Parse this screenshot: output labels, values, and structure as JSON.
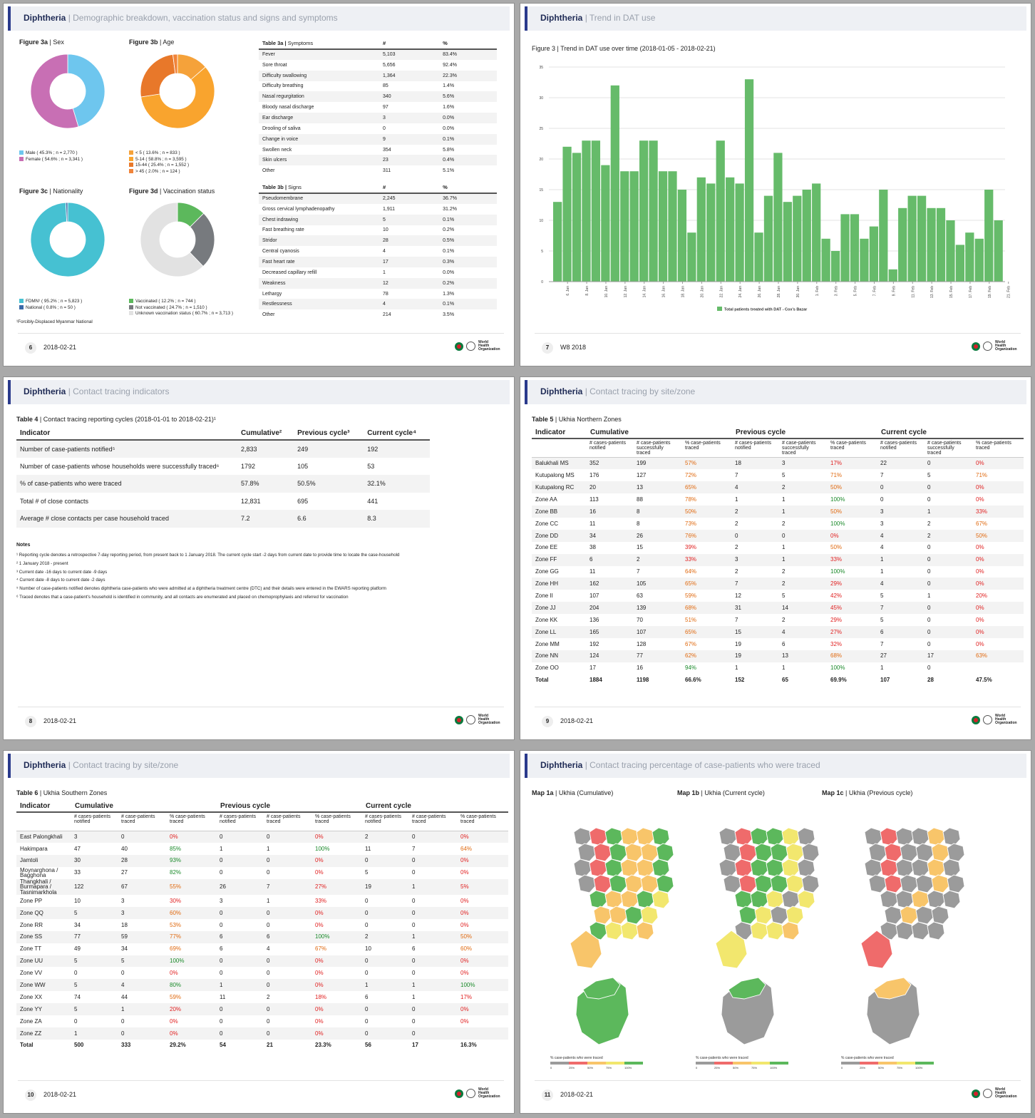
{
  "brand": {
    "title": "Diphtheria",
    "who_line1": "World Health",
    "who_line2": "Organization"
  },
  "slides": {
    "s1": {
      "subtitle": "Demographic breakdown, vaccination status and signs and symptoms",
      "page": "6",
      "date": "2018-02-21"
    },
    "s2": {
      "subtitle": "Trend in DAT use",
      "page": "7",
      "date": "W8 2018"
    },
    "s3": {
      "subtitle": "Contact tracing indicators",
      "page": "8",
      "date": "2018-02-21"
    },
    "s4": {
      "subtitle": "Contact tracing by site/zone",
      "page": "9",
      "date": "2018-02-21"
    },
    "s5": {
      "subtitle": "Contact tracing by site/zone",
      "page": "10",
      "date": "2018-02-21"
    },
    "s6": {
      "subtitle": "Contact tracing percentage of case-patients who were traced",
      "page": "11",
      "date": "2018-02-21"
    }
  },
  "demographics": {
    "sex": {
      "fig": "Figure 3a",
      "name": "Sex",
      "slices": [
        {
          "label": "Male ( 45.3% ; n = 2,770 )",
          "value": 45.3,
          "color": "#6ec6ee"
        },
        {
          "label": "Female ( 54.6% ; n = 3,341 )",
          "value": 54.6,
          "color": "#c86fb4"
        }
      ]
    },
    "age": {
      "fig": "Figure 3b",
      "name": "Age",
      "slices": [
        {
          "label": "< 5 ( 13.6% ; n = 833 )",
          "value": 13.6,
          "color": "#f5a23a"
        },
        {
          "label": "5-14 ( 58.8% ; n = 3,595 )",
          "value": 58.8,
          "color": "#f9a42e"
        },
        {
          "label": "15-44 ( 25.4% ; n = 1,552 )",
          "value": 25.4,
          "color": "#e8782a"
        },
        {
          "label": "> 45 ( 2.0% ; n = 124 )",
          "value": 2.0,
          "color": "#f1843a"
        }
      ]
    },
    "nationality": {
      "fig": "Figure 3c",
      "name": "Nationality",
      "slices": [
        {
          "label": "FDMN¹ ( 95.2% ; n = 5,823 )",
          "value": 95.2,
          "color": "#46c1d2"
        },
        {
          "label": "National ( 0.8% ; n = 50 )",
          "value": 0.8,
          "color": "#3a69a8"
        }
      ]
    },
    "vaccination": {
      "fig": "Figure 3d",
      "name": "Vaccination status",
      "slices": [
        {
          "label": "Vaccinated ( 12.2% ; n = 744 )",
          "value": 12.2,
          "color": "#5cb85c"
        },
        {
          "label": "Not vaccinated ( 24.7% ; n = 1,510 )",
          "value": 24.7,
          "color": "#777a7e"
        },
        {
          "label": "Unknown vaccination status ( 60.7% ; n = 3,713 )",
          "value": 60.7,
          "color": "#e2e2e2"
        }
      ]
    },
    "footnote": "¹Forcibly-Displaced Myanmar National"
  },
  "symptoms": {
    "fig": "Table 3a",
    "name": "Symptoms",
    "col_n": "#",
    "col_p": "%",
    "rows": [
      [
        "Fever",
        "5,103",
        "83.4%"
      ],
      [
        "Sore throat",
        "5,656",
        "92.4%"
      ],
      [
        "Difficulty swallowing",
        "1,364",
        "22.3%"
      ],
      [
        "Difficulty breathing",
        "85",
        "1.4%"
      ],
      [
        "Nasal regurgitation",
        "340",
        "5.6%"
      ],
      [
        "Bloody nasal discharge",
        "97",
        "1.6%"
      ],
      [
        "Ear discharge",
        "3",
        "0.0%"
      ],
      [
        "Drooling of saliva",
        "0",
        "0.0%"
      ],
      [
        "Change in voice",
        "9",
        "0.1%"
      ],
      [
        "Swollen neck",
        "354",
        "5.8%"
      ],
      [
        "Skin ulcers",
        "23",
        "0.4%"
      ],
      [
        "Other",
        "311",
        "5.1%"
      ]
    ]
  },
  "signs": {
    "fig": "Table 3b",
    "name": "Signs",
    "col_n": "#",
    "col_p": "%",
    "rows": [
      [
        "Pseudomembrane",
        "2,245",
        "36.7%"
      ],
      [
        "Gross cervical lymphadenopathy",
        "1,911",
        "31.2%"
      ],
      [
        "Chest indrawing",
        "5",
        "0.1%"
      ],
      [
        "Fast breathing rate",
        "10",
        "0.2%"
      ],
      [
        "Stridor",
        "28",
        "0.5%"
      ],
      [
        "Central cyanosis",
        "4",
        "0.1%"
      ],
      [
        "Fast heart rate",
        "17",
        "0.3%"
      ],
      [
        "Decreased capillary refill",
        "1",
        "0.0%"
      ],
      [
        "Weakness",
        "12",
        "0.2%"
      ],
      [
        "Lethargy",
        "78",
        "1.3%"
      ],
      [
        "Restlessness",
        "4",
        "0.1%"
      ],
      [
        "Other",
        "214",
        "3.5%"
      ]
    ]
  },
  "chart_data": {
    "type": "bar",
    "title": "Figure 3 | Trend in DAT use over time (2018-01-05 - 2018-02-21)",
    "ylim": [
      0,
      35
    ],
    "yticks": [
      0,
      5,
      10,
      15,
      20,
      25,
      30,
      35
    ],
    "xticks": [
      "6. Jan",
      "8. Jan",
      "10. Jan",
      "12. Jan",
      "14. Jan",
      "16. Jan",
      "18. Jan",
      "20. Jan",
      "22. Jan",
      "24. Jan",
      "26. Jan",
      "28. Jan",
      "30. Jan",
      "1. Feb",
      "3. Feb",
      "5. Feb",
      "7. Feb",
      "9. Feb",
      "11. Feb",
      "13. Feb",
      "15. Feb",
      "17. Feb",
      "19. Feb",
      "21. Feb"
    ],
    "series": [
      {
        "name": "Total patients treated with DAT - Cox's Bazar",
        "color": "#66bb6a",
        "values": [
          13,
          22,
          21,
          23,
          23,
          19,
          32,
          18,
          18,
          23,
          23,
          18,
          18,
          15,
          8,
          17,
          16,
          23,
          17,
          16,
          33,
          8,
          14,
          21,
          13,
          14,
          15,
          16,
          7,
          5,
          11,
          11,
          7,
          9,
          15,
          2,
          12,
          14,
          14,
          12,
          12,
          10,
          6,
          8,
          7,
          15,
          10
        ]
      }
    ]
  },
  "table4": {
    "title_b": "Table 4",
    "title": "Contact tracing reporting cycles (2018-01-01 to 2018-02-21)¹",
    "headers": [
      "Indicator",
      "Cumulative²",
      "Previous cycle³",
      "Current cycle⁴"
    ],
    "rows": [
      [
        "Number of case-patients notified⁵",
        "2,833",
        "249",
        "192"
      ],
      [
        "Number of case-patients whose households were successfully traced⁶",
        "1792",
        "105",
        "53"
      ],
      [
        "% of case-patients who were traced",
        "57.8%",
        "50.5%",
        "32.1%"
      ],
      [
        "Total # of close contacts",
        "12,831",
        "695",
        "441"
      ],
      [
        "Average # close contacts per case household traced",
        "7.2",
        "6.6",
        "8.3"
      ]
    ]
  },
  "notes": {
    "heading": "Notes",
    "items": [
      "¹ Reporting cycle denotes a retrospective 7-day reporting period, from present back to 1 January 2018. The current cycle start -2 days from current date to provide time to locate the case-household",
      "² 1 January 2018 - present",
      "³ Current date -16 days to current date -9 days",
      "⁴ Current date -8 days to current date -2 days",
      "⁵ Number of case-patients notified denotes diphtheria case-patients who were admitted at a diphtheria treatment centre (DTC) and their details were entered in the EWARS reporting platform",
      "⁶ Traced denotes that a case-patient's household is identified in community, and all contacts are enumerated and placed on chemoprophylaxis and referred for vaccination"
    ]
  },
  "zone_headers": {
    "indicator": "Indicator",
    "groups": [
      "Cumulative",
      "Previous cycle",
      "Current cycle"
    ],
    "sub": [
      "# cases-patients notified",
      "# case-patients successfully traced",
      "% case-patients traced"
    ]
  },
  "zone_headers_s": {
    "sub": [
      "# cases-patients notified",
      "# case-patients traced",
      "% case-patients traced"
    ]
  },
  "table5": {
    "title_b": "Table 5",
    "title": "Ukhia Northern Zones",
    "rows": [
      [
        "Balukhali MS",
        "352",
        "199",
        "57%",
        "18",
        "3",
        "17%",
        "22",
        "0",
        "0%"
      ],
      [
        "Kutupalong MS",
        "176",
        "127",
        "72%",
        "7",
        "5",
        "71%",
        "7",
        "5",
        "71%"
      ],
      [
        "Kutupalong RC",
        "20",
        "13",
        "65%",
        "4",
        "2",
        "50%",
        "0",
        "0",
        "0%"
      ],
      [
        "Zone AA",
        "113",
        "88",
        "78%",
        "1",
        "1",
        "100%",
        "0",
        "0",
        "0%"
      ],
      [
        "Zone BB",
        "16",
        "8",
        "50%",
        "2",
        "1",
        "50%",
        "3",
        "1",
        "33%"
      ],
      [
        "Zone CC",
        "11",
        "8",
        "73%",
        "2",
        "2",
        "100%",
        "3",
        "2",
        "67%"
      ],
      [
        "Zone DD",
        "34",
        "26",
        "76%",
        "0",
        "0",
        "0%",
        "4",
        "2",
        "50%"
      ],
      [
        "Zone EE",
        "38",
        "15",
        "39%",
        "2",
        "1",
        "50%",
        "4",
        "0",
        "0%"
      ],
      [
        "Zone FF",
        "6",
        "2",
        "33%",
        "3",
        "1",
        "33%",
        "1",
        "0",
        "0%"
      ],
      [
        "Zone GG",
        "11",
        "7",
        "64%",
        "2",
        "2",
        "100%",
        "1",
        "0",
        "0%"
      ],
      [
        "Zone HH",
        "162",
        "105",
        "65%",
        "7",
        "2",
        "29%",
        "4",
        "0",
        "0%"
      ],
      [
        "Zone II",
        "107",
        "63",
        "59%",
        "12",
        "5",
        "42%",
        "5",
        "1",
        "20%"
      ],
      [
        "Zone JJ",
        "204",
        "139",
        "68%",
        "31",
        "14",
        "45%",
        "7",
        "0",
        "0%"
      ],
      [
        "Zone KK",
        "136",
        "70",
        "51%",
        "7",
        "2",
        "29%",
        "5",
        "0",
        "0%"
      ],
      [
        "Zone LL",
        "165",
        "107",
        "65%",
        "15",
        "4",
        "27%",
        "6",
        "0",
        "0%"
      ],
      [
        "Zone MM",
        "192",
        "128",
        "67%",
        "19",
        "6",
        "32%",
        "7",
        "0",
        "0%"
      ],
      [
        "Zone NN",
        "124",
        "77",
        "62%",
        "19",
        "13",
        "68%",
        "27",
        "17",
        "63%"
      ],
      [
        "Zone OO",
        "17",
        "16",
        "94%",
        "1",
        "1",
        "100%",
        "1",
        "0",
        ""
      ]
    ],
    "total": [
      "Total",
      "1884",
      "1198",
      "66.6%",
      "152",
      "65",
      "69.9%",
      "107",
      "28",
      "47.5%"
    ]
  },
  "table6": {
    "title_b": "Table 6",
    "title": "Ukhia Southern Zones",
    "rows": [
      [
        "East Palongkhali",
        "3",
        "0",
        "0%",
        "0",
        "0",
        "0%",
        "2",
        "0",
        "0%"
      ],
      [
        "Hakimpara",
        "47",
        "40",
        "85%",
        "1",
        "1",
        "100%",
        "11",
        "7",
        "64%"
      ],
      [
        "Jamtoli",
        "30",
        "28",
        "93%",
        "0",
        "0",
        "0%",
        "0",
        "0",
        "0%"
      ],
      [
        "Moynarghona / Bagghona",
        "33",
        "27",
        "82%",
        "0",
        "0",
        "0%",
        "5",
        "0",
        "0%"
      ],
      [
        "Thangkhali / Burmapara / Tasnimarkhola",
        "122",
        "67",
        "55%",
        "26",
        "7",
        "27%",
        "19",
        "1",
        "5%"
      ],
      [
        "Zone PP",
        "10",
        "3",
        "30%",
        "3",
        "1",
        "33%",
        "0",
        "0",
        "0%"
      ],
      [
        "Zone QQ",
        "5",
        "3",
        "60%",
        "0",
        "0",
        "0%",
        "0",
        "0",
        "0%"
      ],
      [
        "Zone RR",
        "34",
        "18",
        "53%",
        "0",
        "0",
        "0%",
        "0",
        "0",
        "0%"
      ],
      [
        "Zone SS",
        "77",
        "59",
        "77%",
        "6",
        "6",
        "100%",
        "2",
        "1",
        "50%"
      ],
      [
        "Zone TT",
        "49",
        "34",
        "69%",
        "6",
        "4",
        "67%",
        "10",
        "6",
        "60%"
      ],
      [
        "Zone UU",
        "5",
        "5",
        "100%",
        "0",
        "0",
        "0%",
        "0",
        "0",
        "0%"
      ],
      [
        "Zone VV",
        "0",
        "0",
        "0%",
        "0",
        "0",
        "0%",
        "0",
        "0",
        "0%"
      ],
      [
        "Zone WW",
        "5",
        "4",
        "80%",
        "1",
        "0",
        "0%",
        "1",
        "1",
        "100%"
      ],
      [
        "Zone XX",
        "74",
        "44",
        "59%",
        "11",
        "2",
        "18%",
        "6",
        "1",
        "17%"
      ],
      [
        "Zone YY",
        "5",
        "1",
        "20%",
        "0",
        "0",
        "0%",
        "0",
        "0",
        "0%"
      ],
      [
        "Zone ZA",
        "0",
        "0",
        "0%",
        "0",
        "0",
        "0%",
        "0",
        "0",
        "0%"
      ],
      [
        "Zone ZZ",
        "1",
        "0",
        "0%",
        "0",
        "0",
        "0%",
        "0",
        "0",
        ""
      ]
    ],
    "total": [
      "Total",
      "500",
      "333",
      "29.2%",
      "54",
      "21",
      "23.3%",
      "56",
      "17",
      "16.3%"
    ]
  },
  "maps": {
    "items": [
      {
        "b": "Map 1a",
        "t": "Ukhia (Cumulative)"
      },
      {
        "b": "Map 1b",
        "t": "Ukhia (Current cycle)"
      },
      {
        "b": "Map 1c",
        "t": "Ukhia (Previous cycle)"
      }
    ],
    "legend_title": "% case-patients who were traced",
    "legend_ticks": [
      "0",
      "25%",
      "50%",
      "75%",
      "100%"
    ],
    "colors": {
      "grey": "#9b9b9b",
      "red": "#ef6b6b",
      "orange": "#f8c56a",
      "yellow": "#f2e76e",
      "green": "#5cb85c"
    }
  }
}
